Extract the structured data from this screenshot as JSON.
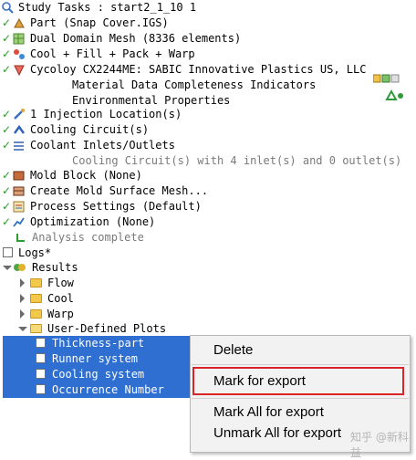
{
  "tree": {
    "study": "Study Tasks : start2_1_10 1",
    "part": "Part (Snap Cover.IGS)",
    "mesh": "Dual Domain Mesh (8336 elements)",
    "analysis": "Cool + Fill + Pack + Warp",
    "material": "Cycoloy CX2244ME: SABIC Innovative Plastics US, LLC",
    "material_sub1": "Material Data Completeness Indicators",
    "material_sub2": "Environmental Properties",
    "injection": "1 Injection Location(s)",
    "cooling": "Cooling Circuit(s)",
    "coolant": "Coolant Inlets/Outlets",
    "coolant_sub": "Cooling Circuit(s) with 4 inlet(s) and 0 outlet(s)",
    "mold_block": "Mold Block (None)",
    "mold_surface": "Create Mold Surface Mesh...",
    "process": "Process Settings (Default)",
    "optimization": "Optimization (None)",
    "analysis_status": "Analysis complete",
    "logs": "Logs*",
    "results": "Results",
    "flow": "Flow",
    "cool": "Cool",
    "warp": "Warp",
    "user_plots": "User-Defined Plots",
    "plots": [
      "Thickness-part",
      "Runner system",
      "Cooling system",
      "Occurrence Number"
    ]
  },
  "context_menu": {
    "delete": "Delete",
    "mark_export": "Mark for export",
    "mark_all": "Mark All for export",
    "unmark_all": "Unmark All for export"
  },
  "watermark": "知乎 @新科益",
  "colors": {
    "selection": "#2f6fd1",
    "check": "#2c9a2c",
    "highlight_border": "#d9252a"
  }
}
